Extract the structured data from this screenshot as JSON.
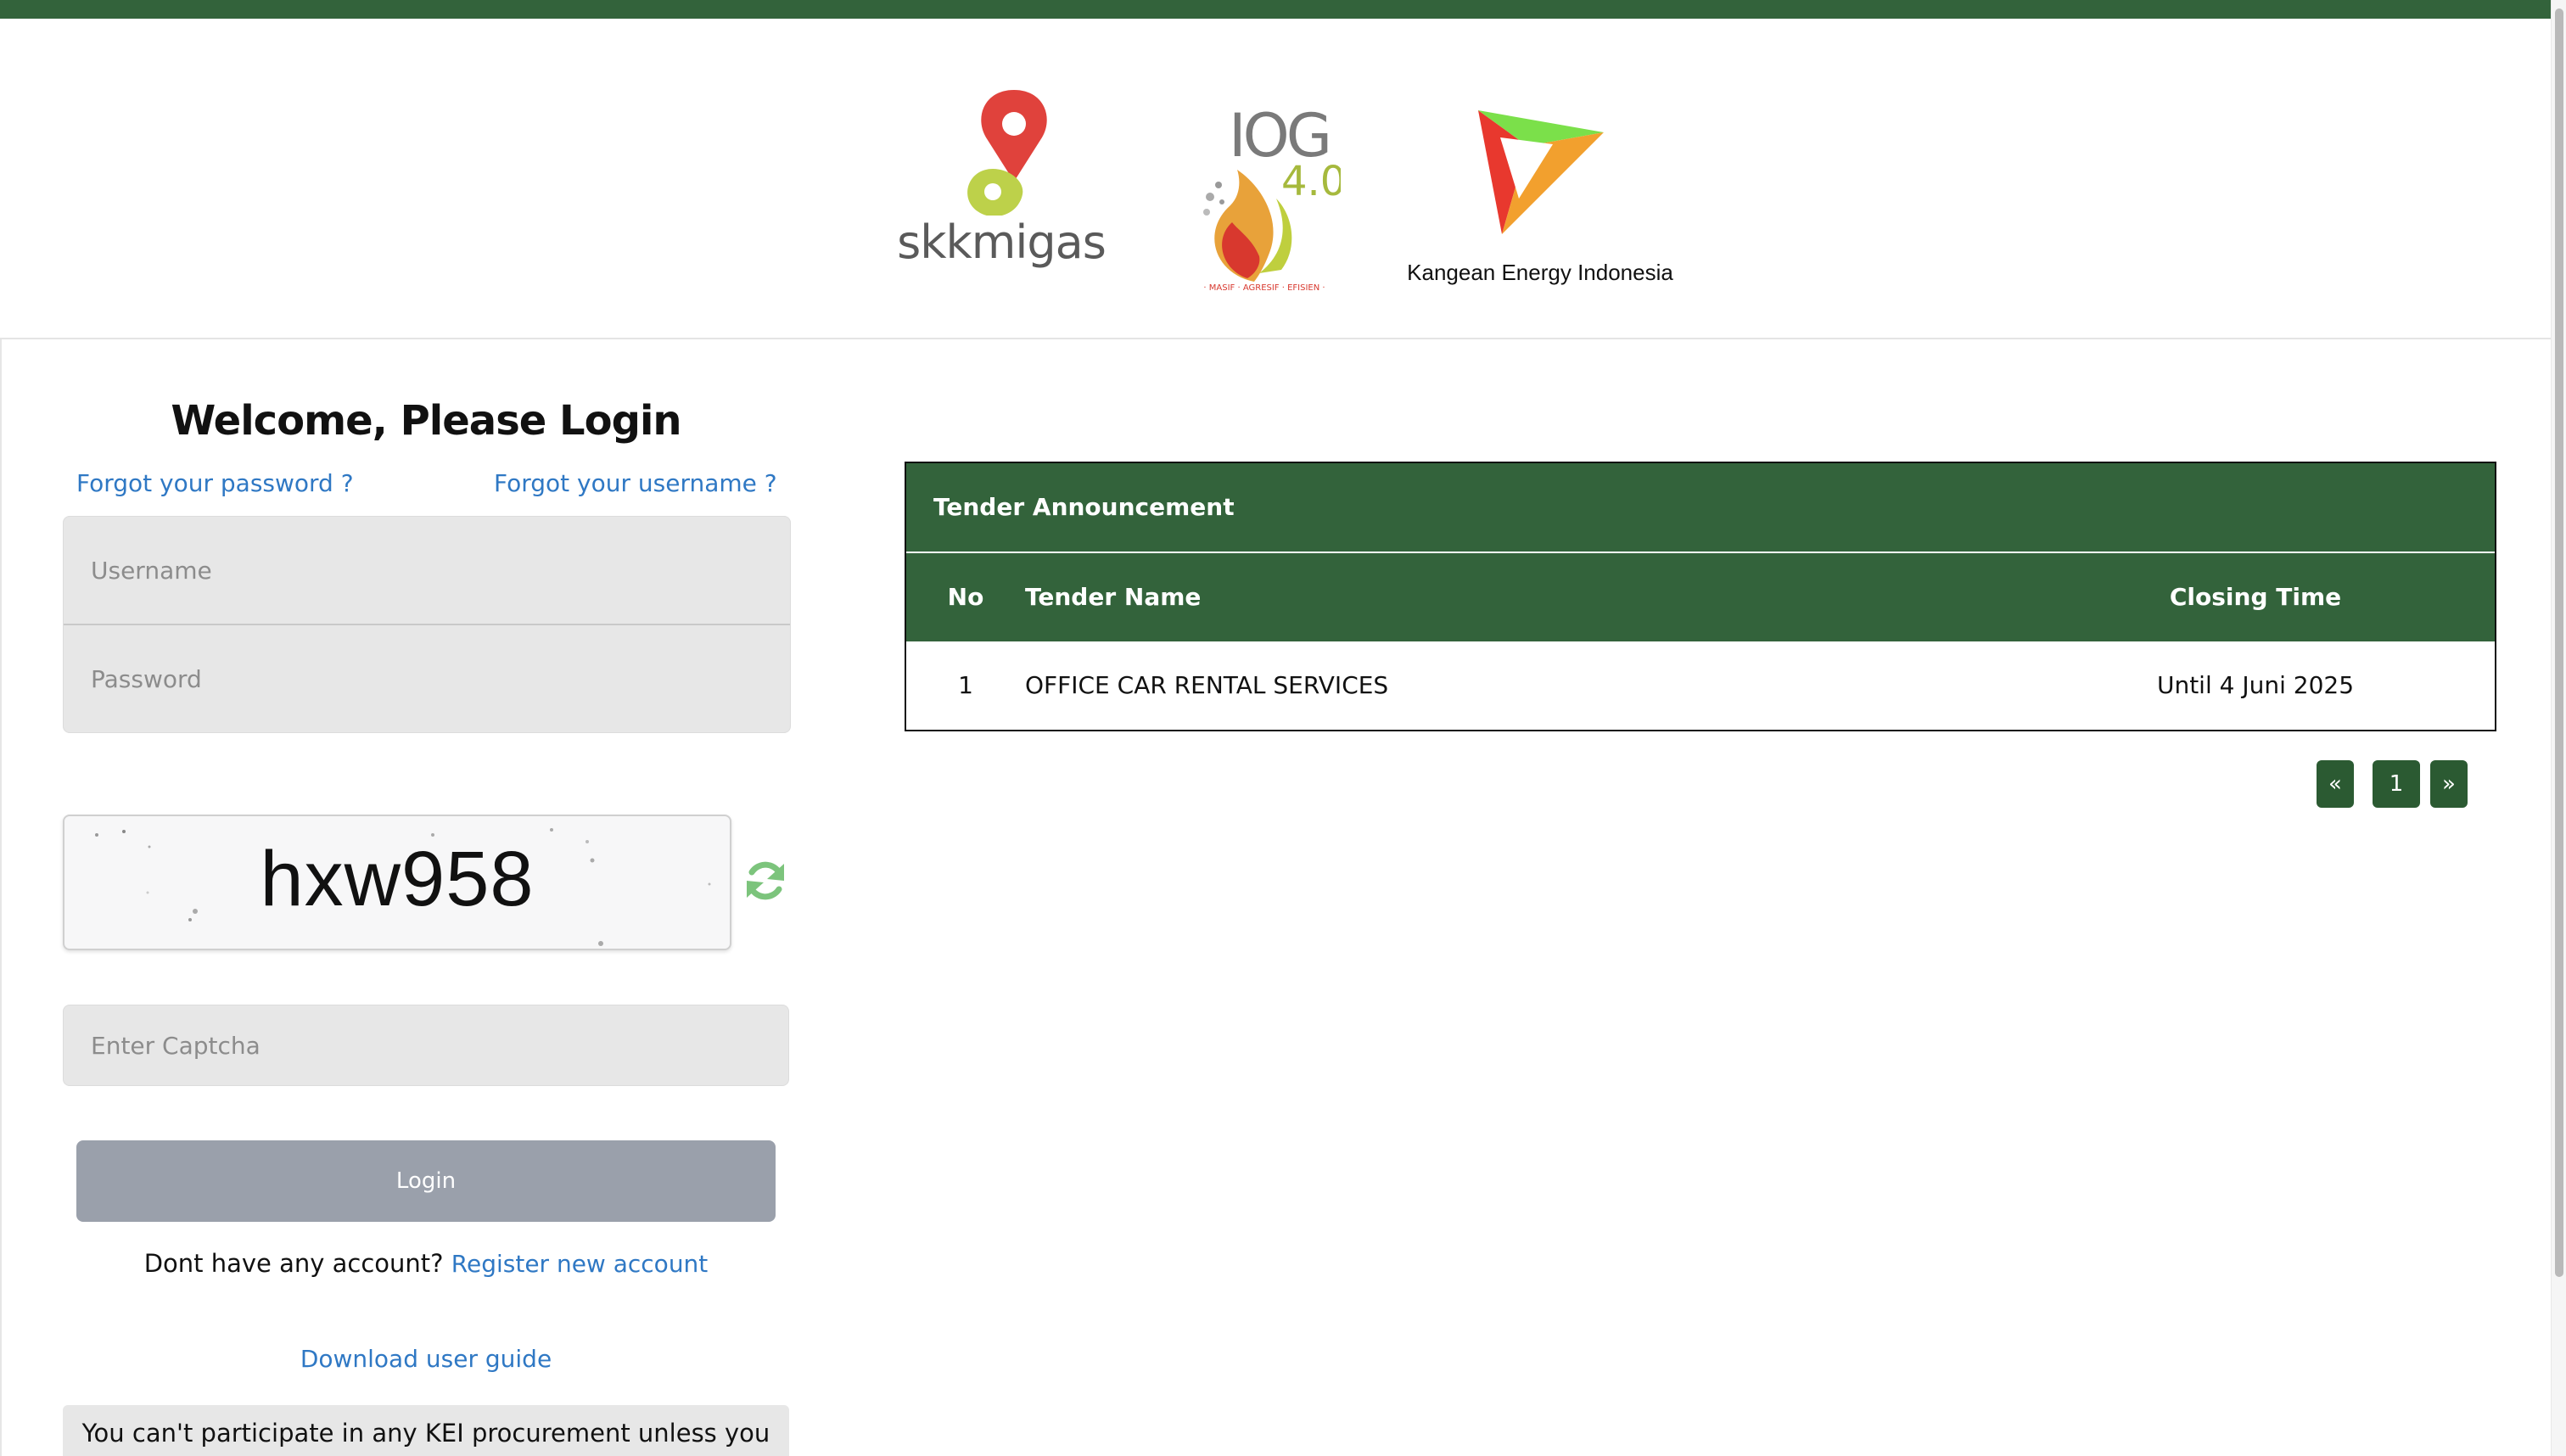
{
  "colors": {
    "brand_green": "#33633b",
    "link_blue": "#2f78c4",
    "button_disabled": "#9aa0ab",
    "input_bg": "#e7e7e7",
    "refresh_green": "#7cc47c"
  },
  "header": {
    "logos": [
      {
        "name": "skkmigas",
        "text": "skkmigas",
        "icon": "skkmigas-logo"
      },
      {
        "name": "iog-4.0",
        "text": "IOG 4.0",
        "icon": "iog-logo"
      },
      {
        "name": "kangean",
        "text": "Kangean Energy Indonesia",
        "icon": "kei-logo"
      }
    ]
  },
  "login": {
    "title": "Welcome, Please Login",
    "forgot_password": "Forgot your password ?",
    "forgot_username": "Forgot your username ?",
    "username_placeholder": "Username",
    "password_placeholder": "Password",
    "captcha_value": "hxw958",
    "captcha_placeholder": "Enter Captcha",
    "login_label": "Login",
    "no_account_text": "Dont have any account?",
    "register_link": "Register new account",
    "guide_link": "Download user guide",
    "notice": "You can't participate in any KEI procurement unless you"
  },
  "tender": {
    "caption": "Tender Announcement",
    "columns": [
      "No",
      "Tender Name",
      "Closing Time"
    ],
    "rows": [
      {
        "no": "1",
        "name": "OFFICE CAR RENTAL SERVICES",
        "closing": "Until 4 Juni 2025"
      }
    ],
    "pagination": {
      "prev": "«",
      "current": "1",
      "next": "»"
    }
  }
}
